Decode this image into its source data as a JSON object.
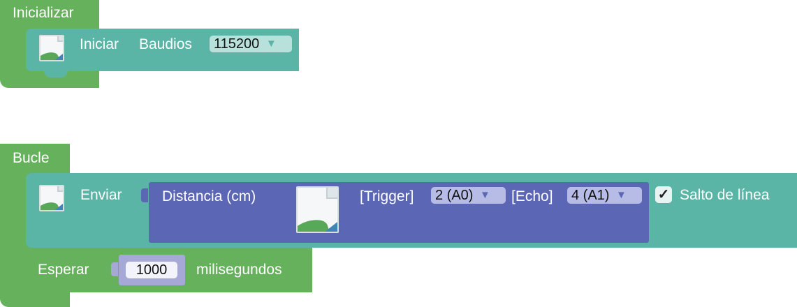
{
  "init_block": {
    "title": "Inicializar",
    "start_label": "Iniciar",
    "baud_label": "Baudios",
    "baud_value": "115200"
  },
  "loop_block": {
    "title": "Bucle",
    "send_label": "Enviar",
    "distance_label": "Distancia (cm)",
    "trigger_label": "[Trigger]",
    "trigger_value": "2 (A0)",
    "echo_label": "[Echo]",
    "echo_value": "4 (A1)",
    "newline_label": "Salto de línea",
    "newline_checked": "✓",
    "wait_label": "Esperar",
    "wait_value": "1000",
    "wait_unit": "milisegundos"
  },
  "icons": {
    "dropdown": "▼"
  }
}
